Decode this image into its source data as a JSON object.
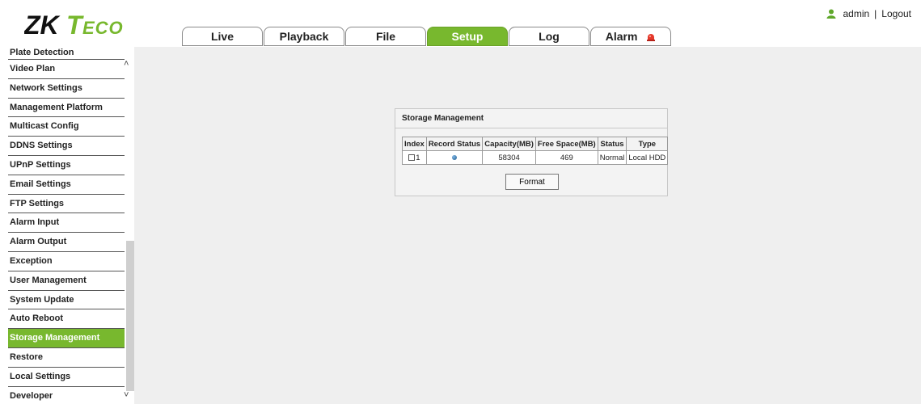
{
  "brand": {
    "logo_text": "ZKTeco",
    "brand_color": "#78b82e"
  },
  "user": {
    "name": "admin",
    "separator": "|",
    "logout": "Logout",
    "icon": "user-icon"
  },
  "tabs": [
    {
      "label": "Live",
      "active": false
    },
    {
      "label": "Playback",
      "active": false
    },
    {
      "label": "File",
      "active": false
    },
    {
      "label": "Setup",
      "active": true
    },
    {
      "label": "Log",
      "active": false
    },
    {
      "label": "Alarm",
      "active": false,
      "icon": "alarm-bell-icon"
    }
  ],
  "sidebar": {
    "items": [
      {
        "label": "Plate Detection"
      },
      {
        "label": "Video Plan"
      },
      {
        "label": "Network Settings"
      },
      {
        "label": "Management Platform"
      },
      {
        "label": "Multicast Config"
      },
      {
        "label": "DDNS Settings"
      },
      {
        "label": "UPnP Settings"
      },
      {
        "label": "Email Settings"
      },
      {
        "label": "FTP Settings"
      },
      {
        "label": "Alarm Input"
      },
      {
        "label": "Alarm Output"
      },
      {
        "label": "Exception"
      },
      {
        "label": "User Management"
      },
      {
        "label": "System Update"
      },
      {
        "label": "Auto Reboot"
      },
      {
        "label": "Storage Management",
        "active": true
      },
      {
        "label": "Restore"
      },
      {
        "label": "Local Settings"
      },
      {
        "label": "Developer"
      }
    ]
  },
  "storage": {
    "title": "Storage Management",
    "columns": [
      "Index",
      "Record Status",
      "Capacity(MB)",
      "Free Space(MB)",
      "Status",
      "Type"
    ],
    "rows": [
      {
        "index": "1",
        "record_status": "status-dot-icon",
        "capacity": "58304",
        "free_space": "469",
        "status": "Normal",
        "type": "Local HDD"
      }
    ],
    "format_button": "Format"
  }
}
